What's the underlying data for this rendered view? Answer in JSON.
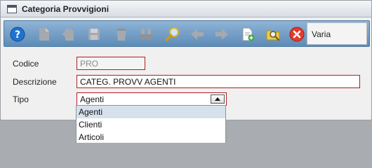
{
  "window": {
    "title": "Categoria Provvigioni"
  },
  "toolbar": {
    "buttons": [
      {
        "name": "help",
        "icon": "help-icon"
      },
      {
        "name": "new",
        "icon": "new-document-icon"
      },
      {
        "name": "duplicate",
        "icon": "copy-document-icon"
      },
      {
        "name": "save",
        "icon": "save-icon"
      },
      {
        "name": "delete",
        "icon": "trash-icon"
      },
      {
        "name": "find",
        "icon": "binoculars-icon"
      },
      {
        "name": "search",
        "icon": "magnifier-icon"
      },
      {
        "name": "previous",
        "icon": "arrow-left-icon"
      },
      {
        "name": "next",
        "icon": "arrow-right-icon"
      },
      {
        "name": "export",
        "icon": "export-document-icon"
      },
      {
        "name": "lookup",
        "icon": "folder-search-icon"
      },
      {
        "name": "close",
        "icon": "close-icon"
      }
    ],
    "mode_label": "Varia"
  },
  "form": {
    "codice": {
      "label": "Codice",
      "value": "PRO"
    },
    "descrizione": {
      "label": "Descrizione",
      "value": "CATEG. PROVV AGENTI"
    },
    "tipo": {
      "label": "Tipo",
      "value": "Agenti",
      "options": [
        "Agenti",
        "Clienti",
        "Articoli"
      ]
    }
  },
  "colors": {
    "accent": "#b01e1e",
    "toolbar": "#6f9bc4",
    "selection": "#d6e1ec"
  }
}
